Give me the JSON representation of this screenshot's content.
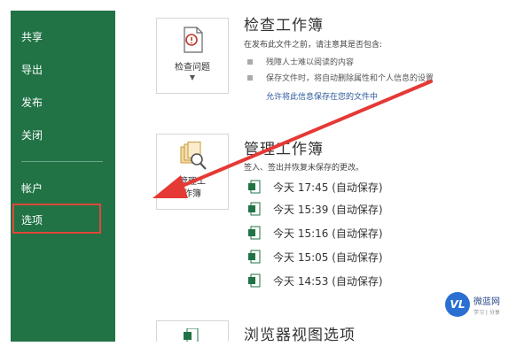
{
  "sidebar": {
    "items": [
      {
        "label": "共享"
      },
      {
        "label": "导出"
      },
      {
        "label": "发布"
      },
      {
        "label": "关闭"
      },
      {
        "label": "帐户"
      },
      {
        "label": "选项"
      }
    ],
    "background": "#217346",
    "highlight_color": "#e0473a"
  },
  "inspect": {
    "button_label": "检查问题",
    "title": "检查工作簿",
    "subtitle": "在发布此文件之前，请注意其是否包含:",
    "bullets": [
      "残障人士难以阅读的内容",
      "保存文件时，将自动删除属性和个人信息的设置"
    ],
    "link": "允许将此信息保存在您的文件中"
  },
  "manage": {
    "button_label_1": "管理工",
    "button_label_2": "作簿",
    "title": "管理工作簿",
    "subtitle": "签入、签出并恢复未保存的更改。",
    "versions": [
      "今天 17:45 (自动保存)",
      "今天 15:39 (自动保存)",
      "今天 15:16 (自动保存)",
      "今天 15:05 (自动保存)",
      "今天 14:53 (自动保存)"
    ]
  },
  "browser": {
    "title": "浏览器视图选项"
  },
  "watermark": {
    "logo": "VL",
    "name": "微蓝网",
    "sub": "学习 | 分享"
  },
  "icons": {
    "inspect": "inspect-document-icon",
    "manage": "manage-workbook-icon",
    "version": "excel-file-icon",
    "arrow": "red-arrow"
  }
}
